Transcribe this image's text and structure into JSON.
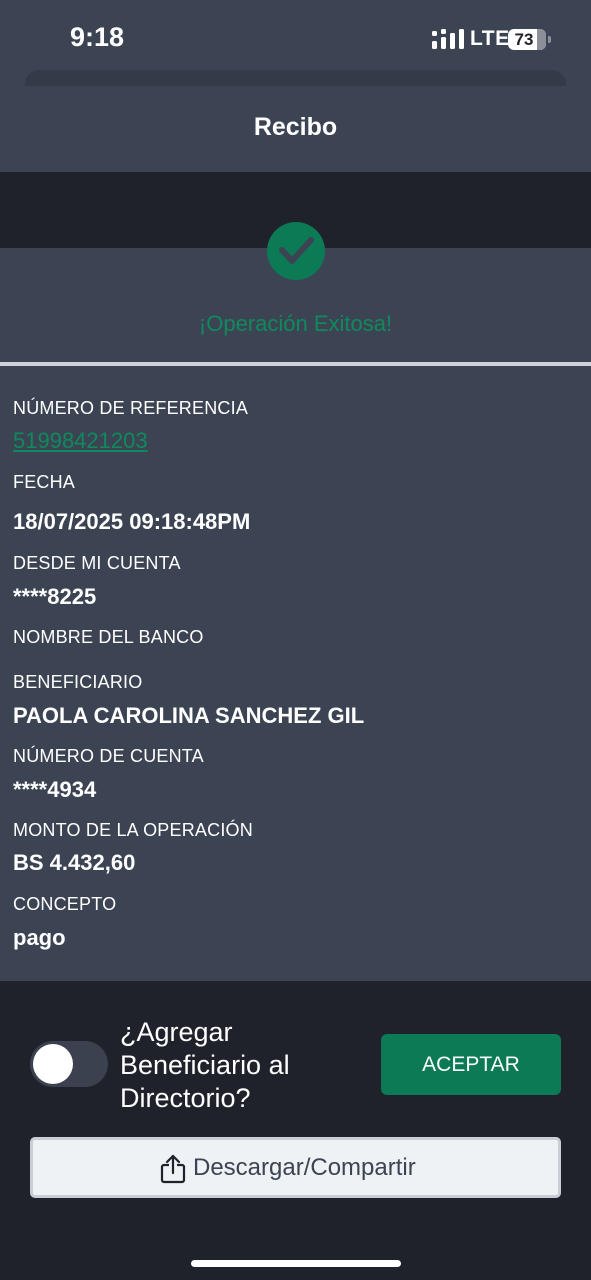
{
  "status_bar": {
    "time": "9:18",
    "network": "LTE",
    "battery": "73"
  },
  "header": {
    "title": "Recibo"
  },
  "success": {
    "message": "¡Operación Exitosa!"
  },
  "fields": {
    "reference_label": "NÚMERO DE REFERENCIA",
    "reference_value": "51998421203",
    "date_label": "FECHA",
    "date_value": "18/07/2025 09:18:48PM",
    "from_account_label": "DESDE MI CUENTA",
    "from_account_value": "****8225",
    "bank_name_label": "NOMBRE DEL BANCO",
    "beneficiary_label": "BENEFICIARIO",
    "beneficiary_value": "PAOLA CAROLINA SANCHEZ GIL",
    "account_number_label": "NÚMERO DE CUENTA",
    "account_number_value": "****4934",
    "amount_label": "MONTO DE LA OPERACIÓN",
    "amount_value": "BS 4.432,60",
    "concept_label": "CONCEPTO",
    "concept_value": "pago"
  },
  "actions": {
    "add_beneficiary_label": "¿Agregar Beneficiario al Directorio?",
    "add_beneficiary_enabled": false,
    "accept_label": "ACEPTAR",
    "share_label": "Descargar/Compartir"
  },
  "colors": {
    "accent_green": "#0b7a55",
    "panel": "#3c4453",
    "background": "#1f222a"
  },
  "icons": {
    "success": "checkmark-circle-icon",
    "share": "share-icon",
    "signal": "cellular-signal-icon",
    "battery": "battery-icon"
  }
}
